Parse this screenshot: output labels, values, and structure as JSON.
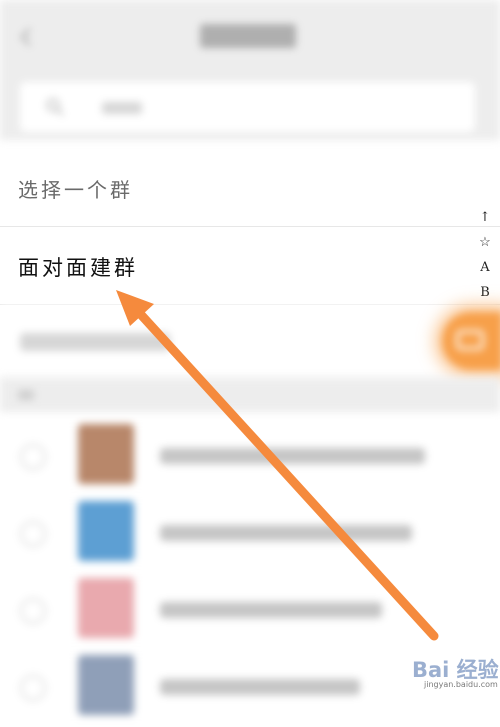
{
  "options": [
    {
      "label": "选择一个群"
    },
    {
      "label": "面对面建群"
    }
  ],
  "index_bar": [
    "↑",
    "☆",
    "A",
    "B"
  ],
  "list_avatar_colors": [
    "#b8876a",
    "#5d9fd3",
    "#e9a9ae",
    "#8f9fb8"
  ],
  "accent_color": "#f7a04a",
  "arrow_color": "#f58a3d",
  "watermark": {
    "logo": "Bai 经验",
    "url": "jingyan.baidu.com"
  }
}
